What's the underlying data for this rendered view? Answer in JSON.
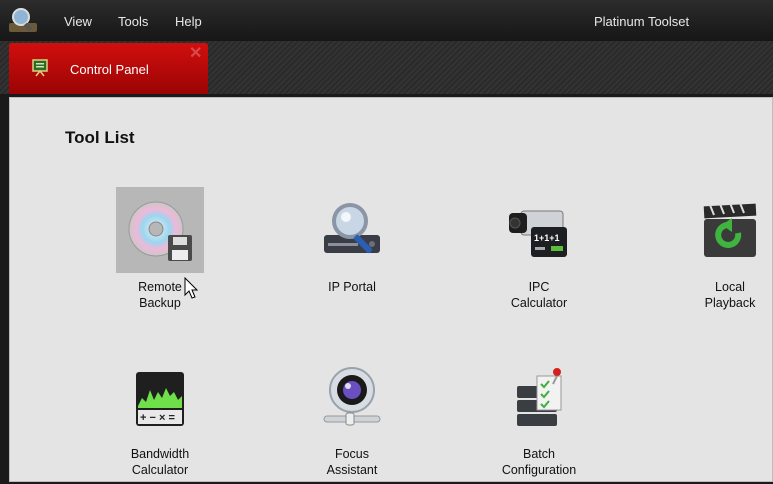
{
  "app": {
    "title": "Platinum Toolset",
    "menu": [
      "View",
      "Tools",
      "Help"
    ]
  },
  "tab": {
    "label": "Control Panel",
    "close_glyph": "✕"
  },
  "panel": {
    "title": "Tool List",
    "tools": [
      {
        "label": "Remote\nBackup",
        "icon": "disc-backup-icon",
        "selected": true
      },
      {
        "label": "IP Portal",
        "icon": "ip-portal-icon",
        "selected": false
      },
      {
        "label": "IPC\nCalculator",
        "icon": "ipc-calculator-icon",
        "selected": false
      },
      {
        "label": "Local\nPlayback",
        "icon": "playback-icon",
        "selected": false
      },
      {
        "label": "Bandwidth\nCalculator",
        "icon": "bandwidth-calculator-icon",
        "selected": false
      },
      {
        "label": "Focus\nAssistant",
        "icon": "focus-lens-icon",
        "selected": false
      },
      {
        "label": "Batch\nConfiguration",
        "icon": "batch-config-icon",
        "selected": false
      }
    ]
  },
  "colors": {
    "tab_active": "#c40b0b",
    "menubar": "#1c1c1c",
    "panel_bg": "#e4e4e4",
    "selection": "#b7b7b7"
  }
}
